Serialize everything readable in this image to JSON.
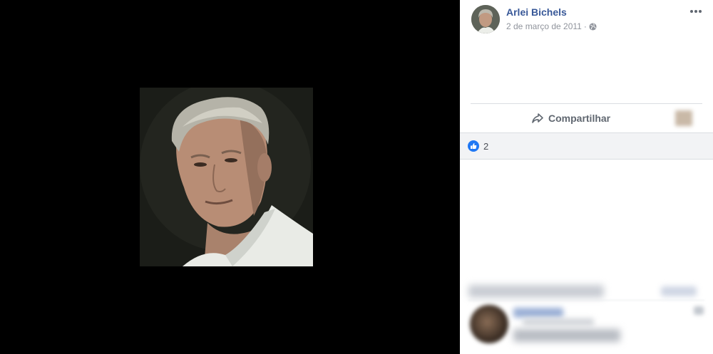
{
  "post": {
    "author_name": "Arlei Bichels",
    "date": "2 de março de 2011",
    "meta_separator": "·",
    "privacy_icon": "globe-icon",
    "more_icon": "more-options-icon"
  },
  "actions": {
    "share_label": "Compartilhar",
    "share_icon": "share-arrow-icon"
  },
  "reactions": {
    "like_icon": "like-icon",
    "count": "2"
  },
  "colors": {
    "author_link": "#385898",
    "meta_text": "#90949c",
    "like_blue": "#2078f4",
    "reactions_bg": "#f2f3f5",
    "stage_bg": "#000000"
  }
}
